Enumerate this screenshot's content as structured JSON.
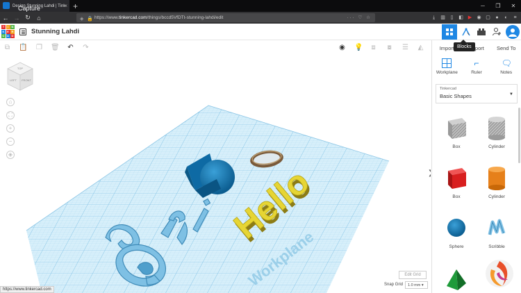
{
  "browser": {
    "tab_title": "Design Stunning Lahdi | Tink",
    "capture_label": "Capture",
    "url_prefix": "https://www.",
    "url_host": "tinkercad.com",
    "url_path": "/things/bccd5VfDTt-stunning-lahdi/edit",
    "status_url": "https://www.tinkercad.com"
  },
  "app": {
    "logo_letters": [
      "T",
      "I",
      "N",
      "K",
      "E",
      "R",
      "C",
      "A",
      "D"
    ],
    "logo_colors": [
      "#e8312f",
      "#f3a21d",
      "#52b848",
      "#1e87e4",
      "#e8312f",
      "#f3a21d",
      "#52b848",
      "#1e87e4",
      "#e8312f"
    ],
    "design_title": "Stunning Lahdi",
    "tooltip": "Blocks"
  },
  "panel": {
    "import_label": "Import",
    "export_label": "Export",
    "sendto_label": "Send To",
    "workplane_label": "Workplane",
    "ruler_label": "Ruler",
    "notes_label": "Notes",
    "library_source": "Tinkercad",
    "library_name": "Basic Shapes",
    "shapes": [
      {
        "label": "Box",
        "icon": "box-striped-icon"
      },
      {
        "label": "Cylinder",
        "icon": "cylinder-striped-icon"
      },
      {
        "label": "Box",
        "icon": "box-red-icon"
      },
      {
        "label": "Cylinder",
        "icon": "cylinder-orange-icon"
      },
      {
        "label": "Sphere",
        "icon": "sphere-blue-icon"
      },
      {
        "label": "Scribble",
        "icon": "scribble-icon"
      }
    ]
  },
  "canvas": {
    "edit_grid": "Edit Grid",
    "snap_grid_label": "Snap Grid",
    "snap_grid_value": "1.0 mm",
    "workplane_text": "Workplane",
    "hello_text": "Hello",
    "viewcube_top": "TOP",
    "viewcube_left": "LEFT",
    "viewcube_front": "FRONT"
  },
  "colors": {
    "accent": "#1e87e4",
    "grid": "#bfe3f6",
    "hello": "#e6d534"
  }
}
